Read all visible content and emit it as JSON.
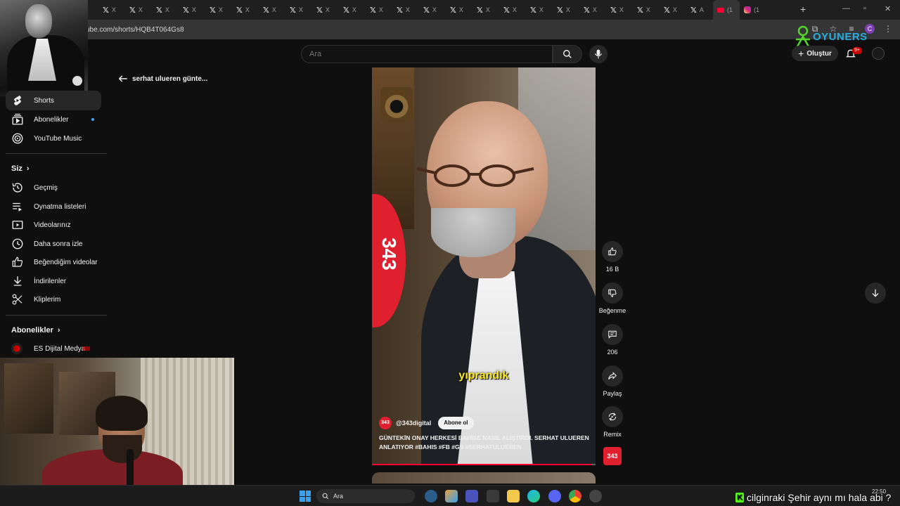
{
  "browser": {
    "tabs": [
      {
        "icon": "x-icon",
        "text": "X"
      },
      {
        "icon": "x-icon",
        "text": "X"
      },
      {
        "icon": "x-icon",
        "text": "X"
      },
      {
        "icon": "x-icon",
        "text": "X"
      },
      {
        "icon": "x-icon",
        "text": "X"
      },
      {
        "icon": "x-icon",
        "text": "X"
      },
      {
        "icon": "x-icon",
        "text": "X"
      },
      {
        "icon": "x-icon",
        "text": "X"
      },
      {
        "icon": "x-icon",
        "text": "X"
      },
      {
        "icon": "x-icon",
        "text": "X"
      },
      {
        "icon": "x-icon",
        "text": "X"
      },
      {
        "icon": "x-icon",
        "text": "X"
      },
      {
        "icon": "x-icon",
        "text": "X"
      },
      {
        "icon": "x-icon",
        "text": "X"
      },
      {
        "icon": "x-icon",
        "text": "X"
      },
      {
        "icon": "x-icon",
        "text": "X"
      },
      {
        "icon": "x-icon",
        "text": "X"
      },
      {
        "icon": "x-icon",
        "text": "X"
      },
      {
        "icon": "x-icon",
        "text": "X"
      },
      {
        "icon": "x-icon",
        "text": "X"
      },
      {
        "icon": "x-icon",
        "text": "X"
      },
      {
        "icon": "x-icon",
        "text": "X"
      },
      {
        "icon": "x-icon",
        "text": "A"
      },
      {
        "icon": "youtube-icon",
        "text": "(1"
      },
      {
        "icon": "instagram-icon",
        "text": "(1"
      }
    ],
    "new_tab": "+",
    "url": "ube.com/shorts/HQB4T064Gs8",
    "profile_initial": "C"
  },
  "overlay": {
    "brand": "OYUNERS"
  },
  "youtube": {
    "search_placeholder": "Ara",
    "create_label": "Oluştur",
    "notif_count": "9+",
    "back_title": "serhat ulueren günte...",
    "sidebar": {
      "primary": [
        {
          "label": "Shorts",
          "icon": "shorts-icon",
          "active": true
        },
        {
          "label": "Abonelikler",
          "icon": "subscriptions-icon",
          "dot": true
        },
        {
          "label": "YouTube Music",
          "icon": "youtube-music-icon"
        }
      ],
      "you_header": "Siz",
      "you_items": [
        {
          "label": "Geçmiş",
          "icon": "history-icon"
        },
        {
          "label": "Oynatma listeleri",
          "icon": "playlists-icon"
        },
        {
          "label": "Videolarınız",
          "icon": "your-videos-icon"
        },
        {
          "label": "Daha sonra izle",
          "icon": "watch-later-icon"
        },
        {
          "label": "Beğendiğim videolar",
          "icon": "liked-videos-icon"
        },
        {
          "label": "İndirilenler",
          "icon": "downloads-icon"
        },
        {
          "label": "Kliplerim",
          "icon": "clips-icon"
        }
      ],
      "subs_header": "Abonelikler",
      "subs_items": [
        {
          "label": "ES Dijital Medya",
          "live": true
        }
      ]
    },
    "short": {
      "caption": "yıprandık",
      "logo_text": "343",
      "channel_handle": "@343digital",
      "channel_avatar": "343",
      "subscribe_label": "Abone ol",
      "title": "GÜNTEKİN ONAY HERKESİ BAHİSE NASIL ALIŞTIRDI. SERHAT ULUEREN ANLATIYOR #bahis #fb #gs #serhatulueren",
      "progress": 0.98
    },
    "actions": {
      "likes": "16 B",
      "dislike_label": "Beğenme",
      "comments": "206",
      "share_label": "Paylaş",
      "remix_label": "Remix",
      "channel_thumb": "343"
    }
  },
  "taskbar": {
    "search_label": "Ara",
    "time": "22:50"
  },
  "chat": {
    "text": "cilginraki Şehir aynı mı hala abi ?"
  },
  "colors": {
    "accent_red": "#ff0033",
    "caption_yellow": "#ffec1a",
    "brand_red": "#e0202f",
    "link_blue": "#3ea6ff",
    "kick_green": "#53fc18"
  }
}
